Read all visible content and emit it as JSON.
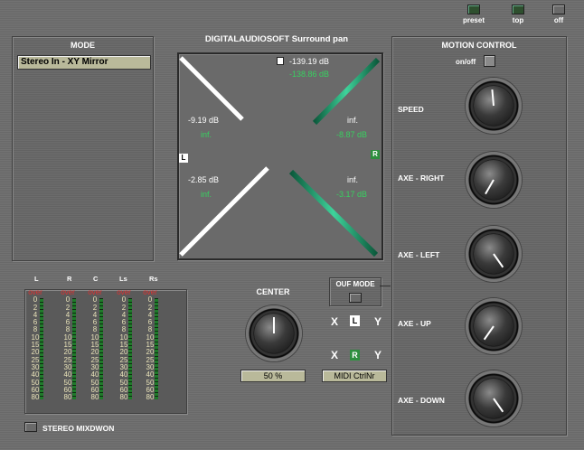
{
  "header": {
    "title": "DIGITALAUDIOSOFT  Surround pan"
  },
  "top_buttons": [
    {
      "label": "preset"
    },
    {
      "label": "top"
    },
    {
      "label": "off"
    }
  ],
  "mode": {
    "title": "MODE",
    "selected": "Stereo In - XY Mirror"
  },
  "meters": {
    "channels": [
      "L",
      "R",
      "C",
      "Ls",
      "Rs"
    ],
    "scale": [
      "over",
      "0",
      "2",
      "4",
      "6",
      "8",
      "10",
      "15",
      "20",
      "25",
      "30",
      "40",
      "50",
      "60",
      "80"
    ]
  },
  "stereo_mixdown": {
    "label": "STEREO MIXDWON"
  },
  "pan": {
    "db": {
      "top_white": "-139.19 dB",
      "top_green": "-138.86 dB",
      "ul_white": "-9.19 dB",
      "ul_green": "inf.",
      "ur_white": "inf.",
      "ur_green": "-8.87 dB",
      "ll_white": "-2.85 dB",
      "ll_green": "inf.",
      "lr_white": "inf.",
      "lr_green": "-3.17 dB"
    },
    "marker_left": "L",
    "marker_right": "R"
  },
  "center": {
    "title": "CENTER",
    "value": "50 %"
  },
  "ouf_mode": {
    "label": "OUF MODE"
  },
  "xy": {
    "x1": "X",
    "l": "L",
    "y1": "Y",
    "x2": "X",
    "r": "R",
    "y2": "Y",
    "midi": "MIDI CtrlNr"
  },
  "motion": {
    "title": "MOTION CONTROL",
    "onoff": "on/off",
    "knobs": [
      {
        "label": "SPEED"
      },
      {
        "label": "AXE - RIGHT"
      },
      {
        "label": "AXE - LEFT"
      },
      {
        "label": "AXE - UP"
      },
      {
        "label": "AXE - DOWN"
      }
    ]
  },
  "colors": {
    "accent_green": "#38d060",
    "meter_over": "#e03030",
    "lcd": "#b9b99a"
  }
}
